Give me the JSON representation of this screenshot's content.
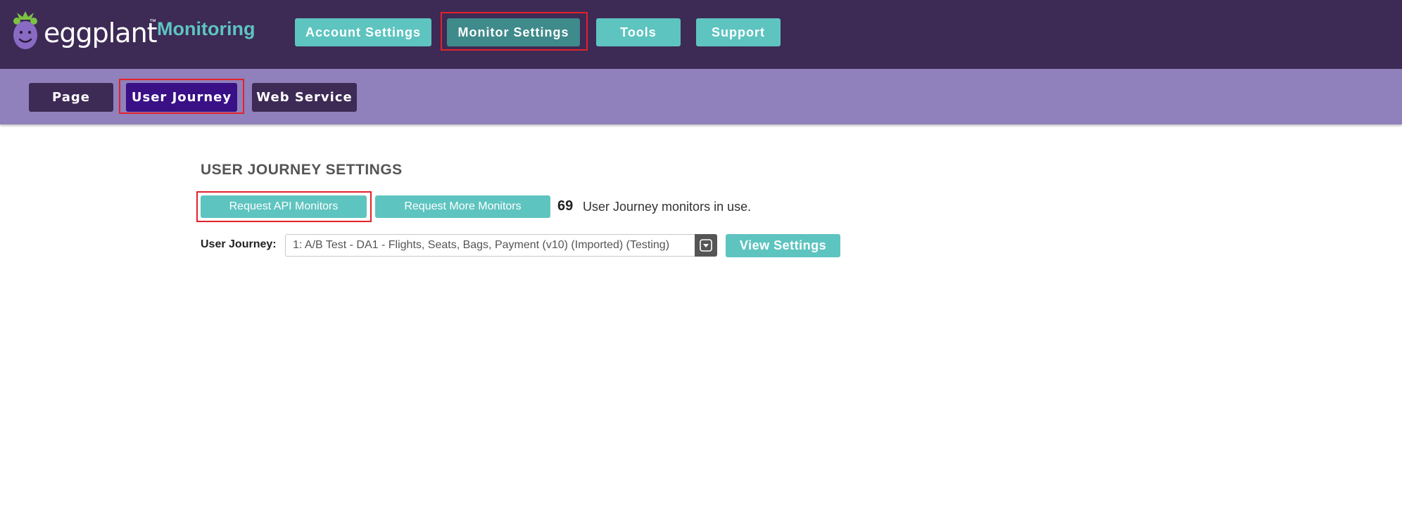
{
  "brand": {
    "name": "eggplant",
    "product": "Monitoring",
    "tm": "™",
    "colors": {
      "header_bg": "#3d2a55",
      "subnav_bg": "#9080bb",
      "accent": "#5ec4c0",
      "highlight": "#e3222b"
    }
  },
  "top_nav": {
    "items": [
      {
        "label": "Account Settings"
      },
      {
        "label": "Monitor Settings",
        "active": true
      },
      {
        "label": "Tools"
      },
      {
        "label": "Support"
      }
    ]
  },
  "sub_nav": {
    "items": [
      {
        "label": "Page"
      },
      {
        "label": "User Journey",
        "active": true
      },
      {
        "label": "Web Service"
      }
    ]
  },
  "main": {
    "title": "USER JOURNEY SETTINGS",
    "request_api_label": "Request API Monitors",
    "request_more_label": "Request More Monitors",
    "monitor_count": "69",
    "monitor_text": "User Journey monitors in use.",
    "journey_label": "User Journey:",
    "journey_selected": "1: A/B Test - DA1 - Flights, Seats, Bags, Payment (v10) (Imported) (Testing)",
    "view_settings_label": "View Settings",
    "dropdown_icon": "chevron-down-icon"
  }
}
